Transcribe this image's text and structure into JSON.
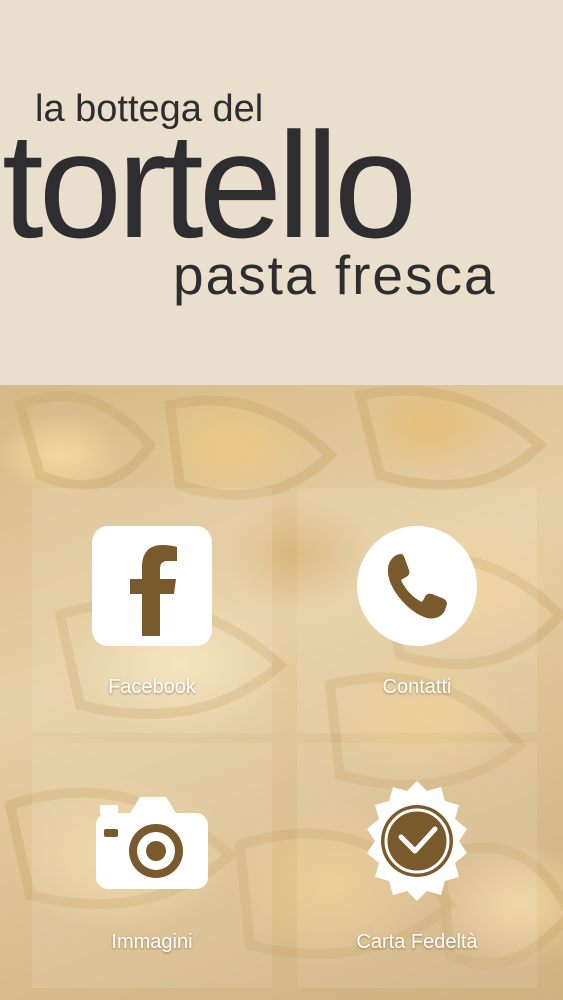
{
  "header": {
    "logo_line1": "la bottega  del",
    "logo_line2": "tortello",
    "logo_line3": "pasta fresca"
  },
  "menu": {
    "tiles": [
      {
        "label": "Facebook",
        "icon": "facebook-icon"
      },
      {
        "label": "Contatti",
        "icon": "phone-icon"
      },
      {
        "label": "Immagini",
        "icon": "camera-icon"
      },
      {
        "label": "Carta Fedeltà",
        "icon": "loyalty-badge-icon"
      }
    ]
  },
  "colors": {
    "header_bg": "#eadfcc",
    "logo_text": "#2e2d2f",
    "icon_fill": "#ffffff",
    "icon_accent": "#7a5a2c"
  }
}
